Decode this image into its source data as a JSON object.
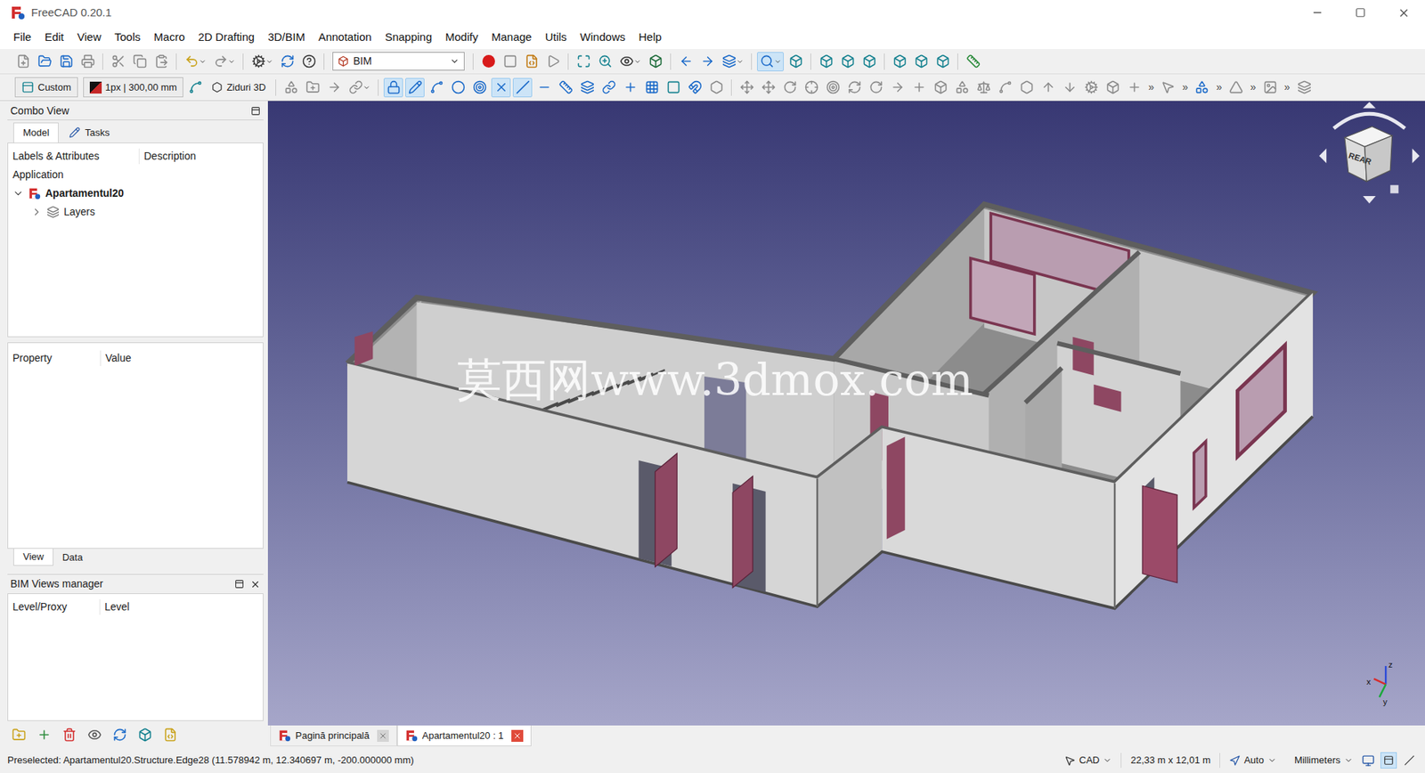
{
  "window": {
    "title": "FreeCAD 0.20.1"
  },
  "menu": [
    "File",
    "Edit",
    "View",
    "Tools",
    "Macro",
    "2D Drafting",
    "3D/BIM",
    "Annotation",
    "Snapping",
    "Modify",
    "Manage",
    "Utils",
    "Windows",
    "Help"
  ],
  "toolbar": {
    "workbench": "BIM",
    "working_plane": "Custom",
    "line_style": "1px | 300,00 mm",
    "wall_tool": "Ziduri 3D",
    "overflow": "»"
  },
  "combo_view": {
    "title": "Combo View",
    "tabs": [
      {
        "label": "Model",
        "selected": true
      },
      {
        "label": "Tasks",
        "selected": false
      }
    ],
    "tree": {
      "columns": [
        "Labels & Attributes",
        "Description"
      ],
      "root": "Application",
      "items": [
        {
          "label": "Apartamentul20",
          "bold": true,
          "expanded": true,
          "depth": 0
        },
        {
          "label": "Layers",
          "bold": false,
          "expanded": false,
          "depth": 1
        }
      ]
    },
    "property": {
      "columns": [
        "Property",
        "Value"
      ],
      "tabs": [
        {
          "label": "View",
          "selected": true
        },
        {
          "label": "Data",
          "selected": false
        }
      ]
    }
  },
  "bim_views": {
    "title": "BIM Views manager",
    "columns": [
      "Level/Proxy",
      "Level"
    ]
  },
  "viewport": {
    "watermark": "莫西网www.3dmox.com",
    "nav_cube_face": "REAR",
    "axes": [
      "z",
      "x",
      "y"
    ]
  },
  "doc_tabs": [
    {
      "label": "Pagină principală",
      "selected": false
    },
    {
      "label": "Apartamentul20 : 1",
      "selected": true
    }
  ],
  "status_bar": {
    "message": "Preselected: Apartamentul20.Structure.Edge28 (11.578942 m, 12.340697 m, -200.000000 mm)",
    "navigation": "CAD",
    "dimensions": "22,33 m x 12,01 m",
    "zoom": "Auto",
    "units": "Millimeters"
  }
}
